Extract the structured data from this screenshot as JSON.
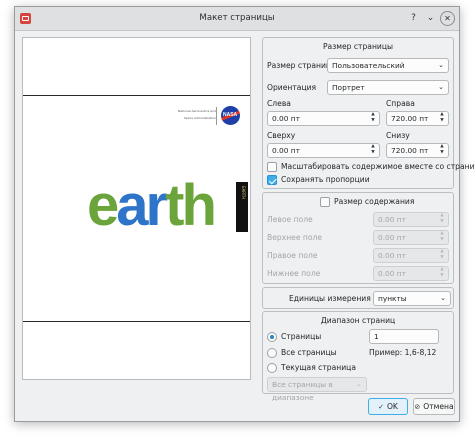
{
  "window": {
    "title": "Макет страницы"
  },
  "preview": {
    "earth_letters": [
      "e",
      "a",
      "r",
      "t",
      "h"
    ],
    "strip_text": "EARTH",
    "logo_text": "NASA",
    "tiny_line1": "National Aeronautics and",
    "tiny_line2": "Space Administration"
  },
  "page_size": {
    "group_title": "Размер страницы",
    "size_label": "Размер страницы",
    "size_value": "Пользовательский",
    "orientation_label": "Ориентация",
    "orientation_value": "Портрет",
    "left_label": "Слева",
    "left_value": "0.00 пт",
    "right_label": "Справа",
    "right_value": "720.00 пт",
    "top_label": "Сверху",
    "top_value": "0.00 пт",
    "bottom_label": "Снизу",
    "bottom_value": "720.00 пт",
    "scale_label": "Масштабировать содержимое вместе со страницей",
    "scale_checked": false,
    "keep_label": "Сохранять пропорции",
    "keep_checked": true
  },
  "content_size": {
    "title": "Размер содержания",
    "checked": false,
    "left_margin_label": "Левое поле",
    "left_margin_value": "0.00 пт",
    "top_margin_label": "Верхнее поле",
    "top_margin_value": "0.00 пт",
    "right_margin_label": "Правое поле",
    "right_margin_value": "0.00 пт",
    "bottom_margin_label": "Нижнее поле",
    "bottom_margin_value": "0.00 пт"
  },
  "units": {
    "label": "Единицы измерения",
    "value": "пункты"
  },
  "page_range": {
    "title": "Диапазон страниц",
    "pages_label": "Страницы",
    "pages_value": "1",
    "all_label": "Все страницы",
    "example": "Пример: 1,6-8,12",
    "current_label": "Текущая страница",
    "filter_value": "Все страницы в диапазоне",
    "selected": "pages"
  },
  "buttons": {
    "ok": "OK",
    "cancel": "Отмена"
  }
}
